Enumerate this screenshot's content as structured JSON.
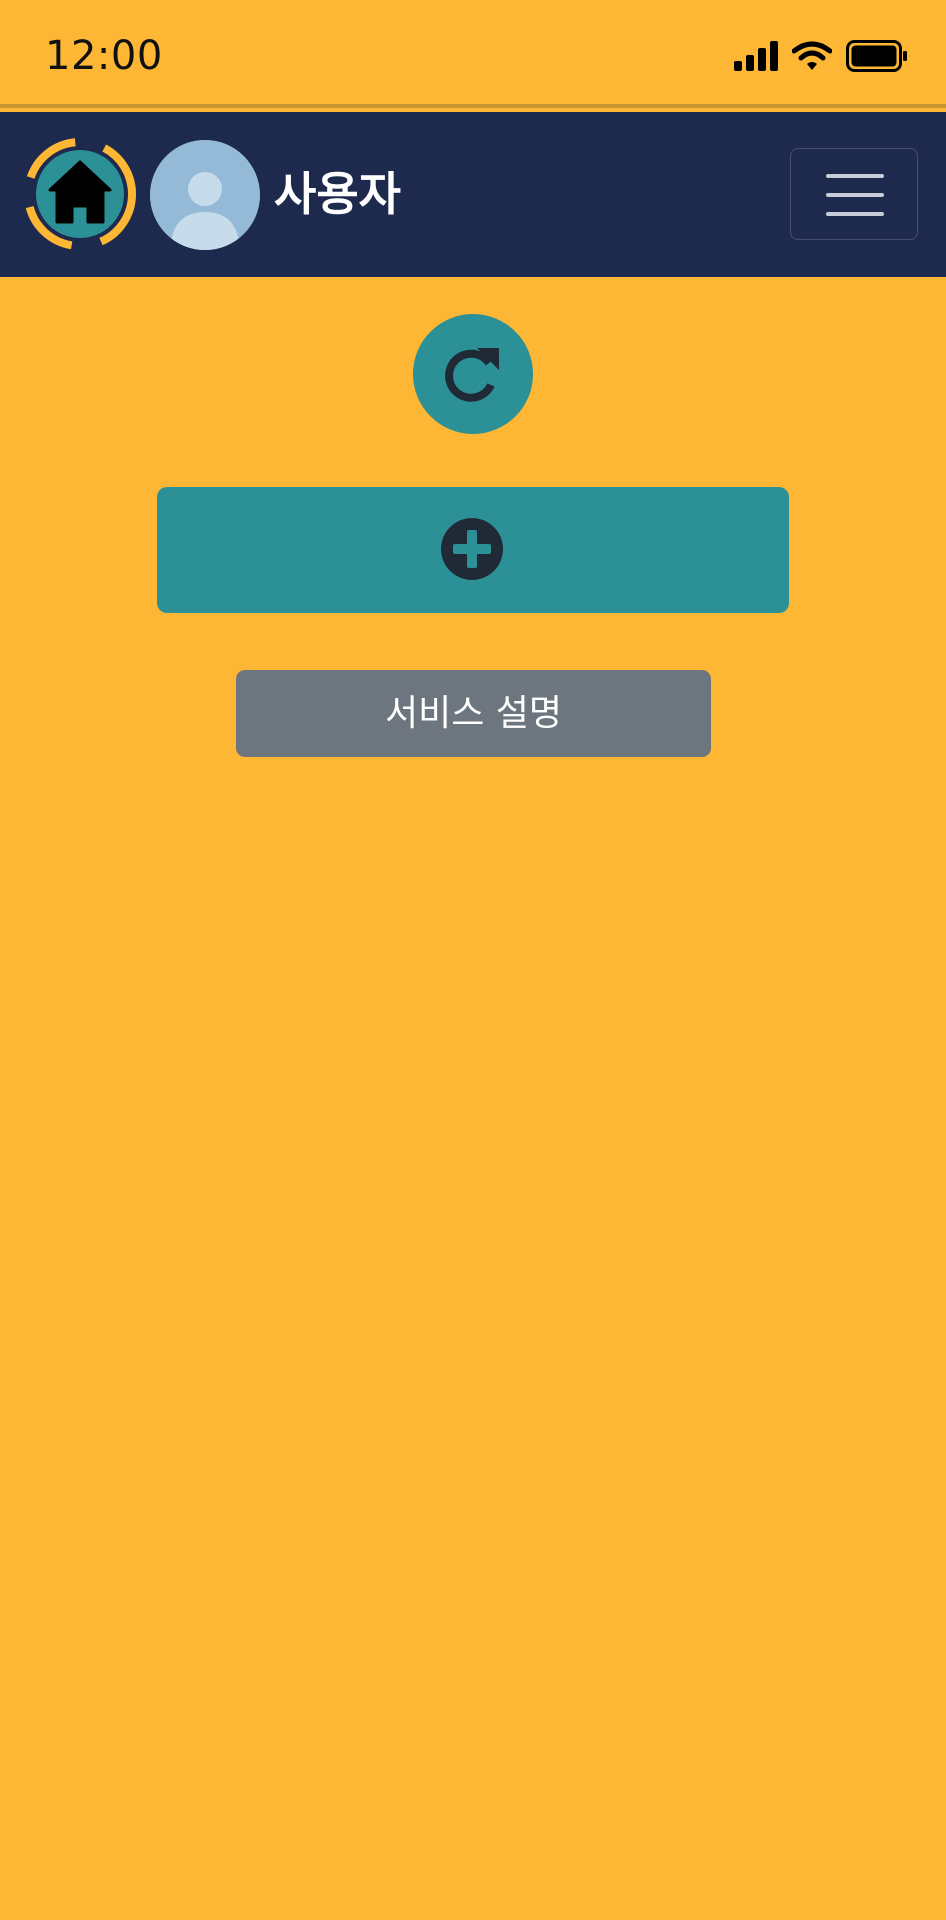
{
  "status_bar": {
    "time": "12:00",
    "icons": [
      "cellular-signal-icon",
      "wifi-icon",
      "battery-icon"
    ]
  },
  "header": {
    "home_icon": "home-icon",
    "avatar_icon": "user-avatar-icon",
    "user_name": "사용자",
    "menu_icon": "hamburger-menu-icon"
  },
  "main": {
    "refresh_icon": "refresh-icon",
    "add_icon": "plus-circle-icon",
    "service_button_label": "서비스 설명"
  },
  "colors": {
    "background": "#FDB735",
    "header": "#1D2A4E",
    "teal": "#2B9197",
    "icon_dark": "#1F2A36",
    "secondary_button": "#6D757E",
    "avatar": "#94BAD8"
  }
}
